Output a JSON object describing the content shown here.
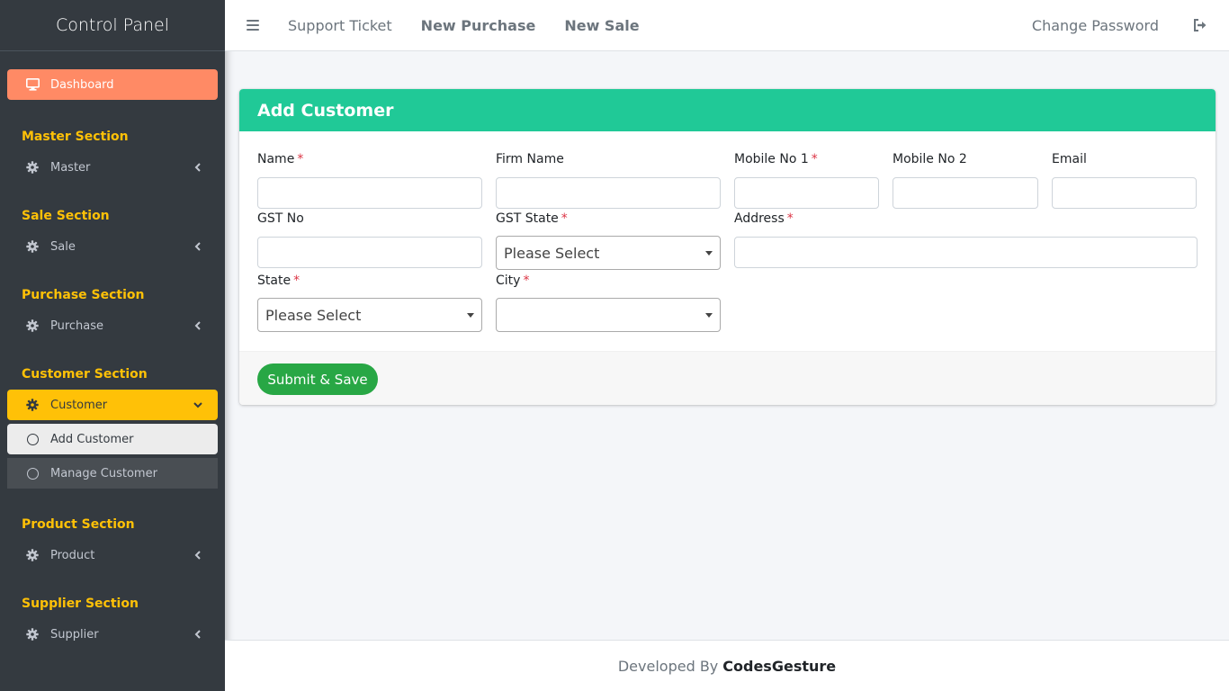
{
  "sidebar": {
    "brand": "Control Panel",
    "dashboard": {
      "label": "Dashboard",
      "icon": "monitor-icon"
    },
    "sections": {
      "master": {
        "header": "Master Section",
        "item": "Master"
      },
      "sale": {
        "header": "Sale Section",
        "item": "Sale"
      },
      "purchase": {
        "header": "Purchase Section",
        "item": "Purchase"
      },
      "customer": {
        "header": "Customer Section",
        "item": "Customer",
        "sub_add": "Add Customer",
        "sub_manage": "Manage Customer"
      },
      "product": {
        "header": "Product Section",
        "item": "Product"
      },
      "supplier": {
        "header": "Supplier Section",
        "item": "Supplier"
      }
    },
    "colors": {
      "bg": "#343a40",
      "dashboard": "#ff8a65",
      "active": "#ffc107",
      "section": "#ffc107"
    }
  },
  "topbar": {
    "links": {
      "support": "Support Ticket",
      "new_purchase": "New Purchase",
      "new_sale": "New Sale"
    },
    "change_password": "Change Password"
  },
  "form": {
    "title": "Add Customer",
    "header_color": "#20c997",
    "fields": {
      "name": {
        "label": "Name",
        "required": "*",
        "value": ""
      },
      "firm_name": {
        "label": "Firm Name",
        "value": ""
      },
      "mobile1": {
        "label": "Mobile No 1",
        "required": "*",
        "value": ""
      },
      "mobile2": {
        "label": "Mobile No 2",
        "value": ""
      },
      "email": {
        "label": "Email",
        "value": ""
      },
      "gst_no": {
        "label": "GST No",
        "value": ""
      },
      "gst_state": {
        "label": "GST State",
        "required": "*",
        "selected": "Please Select"
      },
      "address": {
        "label": "Address",
        "required": "*",
        "value": ""
      },
      "state": {
        "label": "State",
        "required": "*",
        "selected": "Please Select"
      },
      "city": {
        "label": "City",
        "required": "*",
        "selected": ""
      }
    },
    "submit_label": "Submit & Save",
    "submit_color": "#28a745"
  },
  "footer": {
    "prefix": "Developed By",
    "brand": "CodesGesture"
  }
}
